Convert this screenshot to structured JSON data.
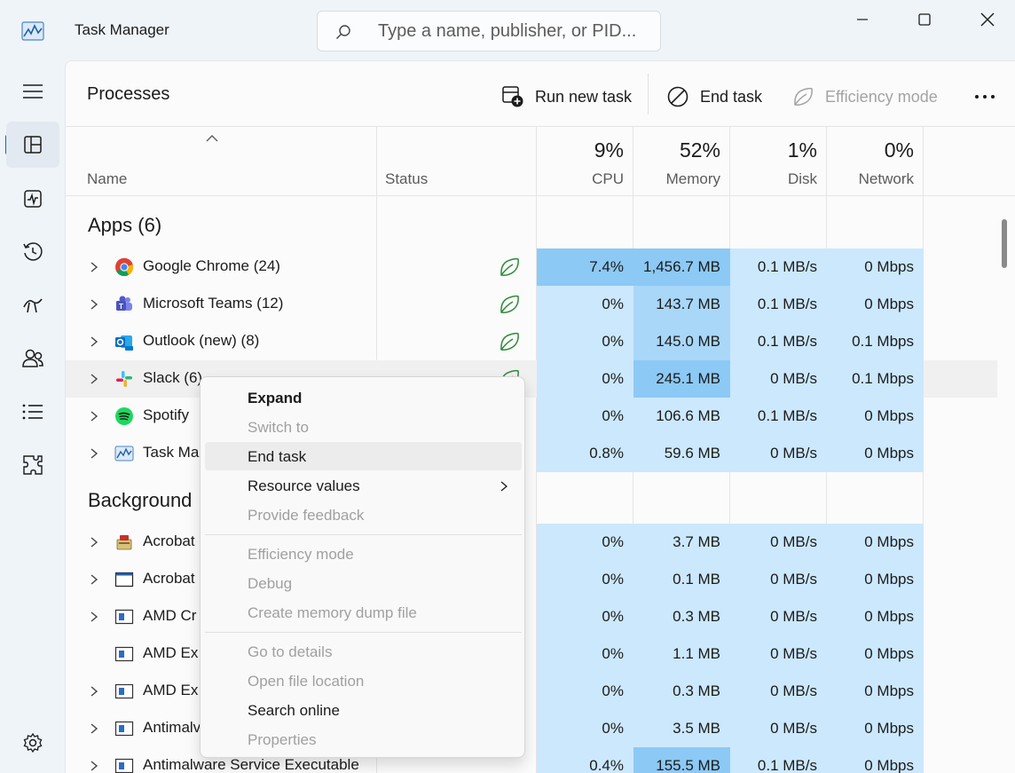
{
  "window": {
    "title": "Task Manager",
    "search_placeholder": "Type a name, publisher, or PID..."
  },
  "nav": {
    "items": [
      "hamburger-icon",
      "processes-icon",
      "performance-icon",
      "app-history-icon",
      "startup-apps-icon",
      "users-icon",
      "details-icon",
      "services-icon",
      "settings-icon"
    ],
    "active": "processes"
  },
  "toolbar": {
    "page_title": "Processes",
    "run_new_task": "Run new task",
    "end_task": "End task",
    "efficiency_mode": "Efficiency mode"
  },
  "columns": {
    "name": "Name",
    "status": "Status",
    "cpu": {
      "pct": "9%",
      "label": "CPU"
    },
    "memory": {
      "pct": "52%",
      "label": "Memory"
    },
    "disk": {
      "pct": "1%",
      "label": "Disk"
    },
    "network": {
      "pct": "0%",
      "label": "Network"
    }
  },
  "groups": {
    "apps": "Apps (6)",
    "background": "Background"
  },
  "apps": [
    {
      "name": "Google Chrome (24)",
      "cpu": "7.4%",
      "memory": "1,456.7 MB",
      "disk": "0.1 MB/s",
      "network": "0 Mbps"
    },
    {
      "name": "Microsoft Teams (12)",
      "cpu": "0%",
      "memory": "143.7 MB",
      "disk": "0.1 MB/s",
      "network": "0 Mbps"
    },
    {
      "name": "Outlook (new) (8)",
      "cpu": "0%",
      "memory": "145.0 MB",
      "disk": "0.1 MB/s",
      "network": "0.1 Mbps"
    },
    {
      "name": "Slack (6)",
      "cpu": "0%",
      "memory": "245.1 MB",
      "disk": "0 MB/s",
      "network": "0.1 Mbps"
    },
    {
      "name": "Spotify",
      "cpu": "0%",
      "memory": "106.6 MB",
      "disk": "0.1 MB/s",
      "network": "0 Mbps"
    },
    {
      "name": "Task Ma",
      "cpu": "0.8%",
      "memory": "59.6 MB",
      "disk": "0 MB/s",
      "network": "0 Mbps"
    }
  ],
  "background": [
    {
      "name": "Acrobat",
      "cpu": "0%",
      "memory": "3.7 MB",
      "disk": "0 MB/s",
      "network": "0 Mbps"
    },
    {
      "name": "Acrobat",
      "cpu": "0%",
      "memory": "0.1 MB",
      "disk": "0 MB/s",
      "network": "0 Mbps"
    },
    {
      "name": "AMD Cr",
      "cpu": "0%",
      "memory": "0.3 MB",
      "disk": "0 MB/s",
      "network": "0 Mbps"
    },
    {
      "name": "AMD Ex",
      "cpu": "0%",
      "memory": "1.1 MB",
      "disk": "0 MB/s",
      "network": "0 Mbps"
    },
    {
      "name": "AMD Ex",
      "cpu": "0%",
      "memory": "0.3 MB",
      "disk": "0 MB/s",
      "network": "0 Mbps"
    },
    {
      "name": "Antimalv",
      "cpu": "0%",
      "memory": "3.5 MB",
      "disk": "0 MB/s",
      "network": "0 Mbps"
    },
    {
      "name": "Antimalware Service Executable",
      "cpu": "0.4%",
      "memory": "155.5 MB",
      "disk": "0.1 MB/s",
      "network": "0 Mbps"
    }
  ],
  "context_menu": {
    "expand": "Expand",
    "switch_to": "Switch to",
    "end_task": "End task",
    "resource_values": "Resource values",
    "provide_feedback": "Provide feedback",
    "efficiency_mode": "Efficiency mode",
    "debug": "Debug",
    "create_memory_dump": "Create memory dump file",
    "go_to_details": "Go to details",
    "open_file_location": "Open file location",
    "search_online": "Search online",
    "properties": "Properties"
  },
  "colors": {
    "heat_low": "#cce8fc",
    "heat_mid": "#a9d7f8",
    "heat_high": "#8cc9f5",
    "accent": "#0f6cbd",
    "efficiency_green": "#2e8b3a"
  }
}
